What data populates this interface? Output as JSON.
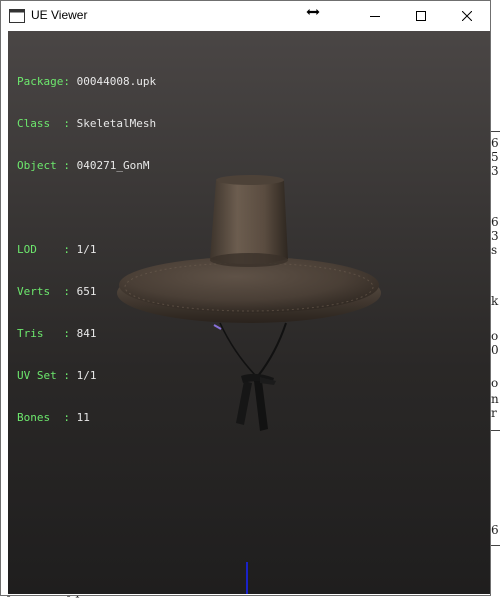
{
  "window": {
    "title": "UE Viewer",
    "controls": {
      "minimize": "minimize-icon",
      "maximize": "maximize-icon",
      "close": "close-icon"
    }
  },
  "info": {
    "package": {
      "key": "Package: ",
      "value": "00044008.upk"
    },
    "class": {
      "key": "Class  : ",
      "value": "SkeletalMesh"
    },
    "object": {
      "key": "Object : ",
      "value": "040271_GonM"
    },
    "lod": {
      "key": "LOD    : ",
      "value": "1/1"
    },
    "verts": {
      "key": "Verts  : ",
      "value": "651"
    },
    "tris": {
      "key": "Tris   : ",
      "value": "841"
    },
    "uvset": {
      "key": "UV Set : ",
      "value": "1/1"
    },
    "bones": {
      "key": "Bones  : ",
      "value": "11"
    }
  },
  "background_console": {
    "right_chars": [
      "6",
      "5",
      "3",
      "6",
      "3",
      "s",
      "k",
      "o",
      "0",
      "o",
      "n",
      "r",
      "6"
    ],
    "left_char": "E",
    "bottom_line": "[DB000II] process  miroma win scobize  exited with code: 0"
  },
  "colors": {
    "info_key": "#6de86d",
    "info_value": "#e8e8e8",
    "axis": "#1a22c8"
  }
}
